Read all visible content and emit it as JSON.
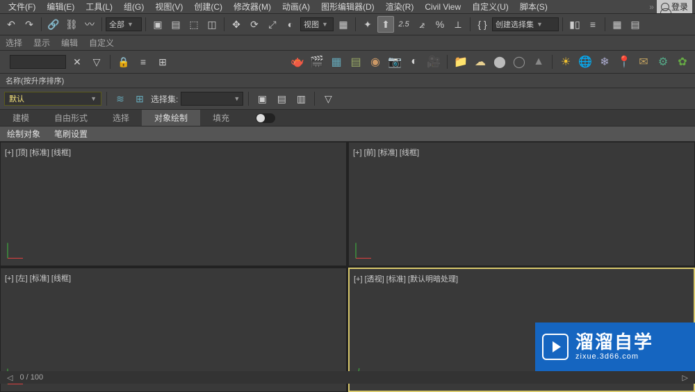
{
  "menubar": {
    "items": [
      "文件(F)",
      "编辑(E)",
      "工具(L)",
      "组(G)",
      "视图(V)",
      "创建(C)",
      "修改器(M)",
      "动画(A)",
      "图形编辑器(D)",
      "渲染(R)",
      "Civil View",
      "自定义(U)",
      "脚本(S)"
    ],
    "login": "登录"
  },
  "toolbar1": {
    "filter_all": "全部",
    "view_label": "视图",
    "scale_value": "2.5",
    "create_set": "创建选择集"
  },
  "subbar": {
    "items": [
      "选择",
      "显示",
      "编辑",
      "自定义"
    ]
  },
  "leftpanel": {
    "name_label": "名称(按升序排序)"
  },
  "row3": {
    "default": "默认",
    "selset_label": "选择集:"
  },
  "tabs": {
    "items": [
      "建模",
      "自由形式",
      "选择",
      "对象绘制",
      "填充"
    ],
    "active": 3
  },
  "subtabs": {
    "items": [
      "绘制对象",
      "笔刷设置"
    ]
  },
  "viewports": {
    "tl": "[+] [顶] [标准] [线框]",
    "tr": "[+] [前] [标准] [线框]",
    "bl": "[+] [左] [标准] [线框]",
    "br": "[+] [透视] [标准] [默认明暗处理]"
  },
  "timeline": {
    "frame": "0 / 100"
  },
  "watermark": {
    "main": "溜溜自学",
    "sub": "zixue.3d66.com"
  }
}
